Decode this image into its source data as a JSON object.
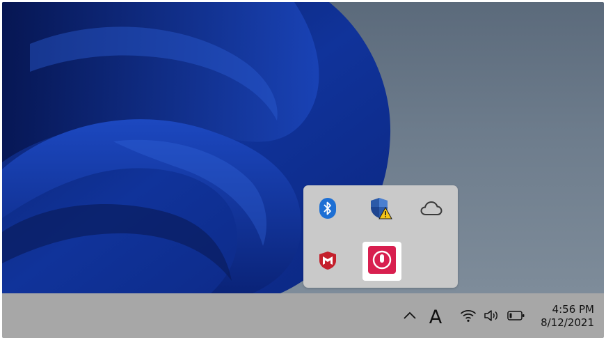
{
  "desktop": {
    "wallpaper": "windows-11-bloom",
    "background_color": "#6b7a8a",
    "bloom_color": "#0f2d8c"
  },
  "flyout": {
    "background_color": "#c9c9c9",
    "items": [
      {
        "icon": "bluetooth-icon",
        "color": "#1d6fd4"
      },
      {
        "icon": "windows-security-warning-icon",
        "color": "#2c5aa8",
        "warning_color": "#f5c518"
      },
      {
        "icon": "onedrive-cloud-icon",
        "color": "#3a3a3a"
      },
      {
        "icon": "mcafee-shield-icon",
        "color": "#c4202c"
      },
      {
        "icon": "microphone-app-icon",
        "color": "#d81f4f",
        "selected": true
      }
    ]
  },
  "taskbar": {
    "background_color": "#a7a7a7",
    "overflow_chevron_icon": "chevron-up-icon",
    "ime_indicator": "A",
    "wifi_icon": "wifi-icon",
    "volume_icon": "volume-icon",
    "battery_icon": "battery-icon",
    "clock": {
      "time": "4:56 PM",
      "date": "8/12/2021"
    }
  }
}
